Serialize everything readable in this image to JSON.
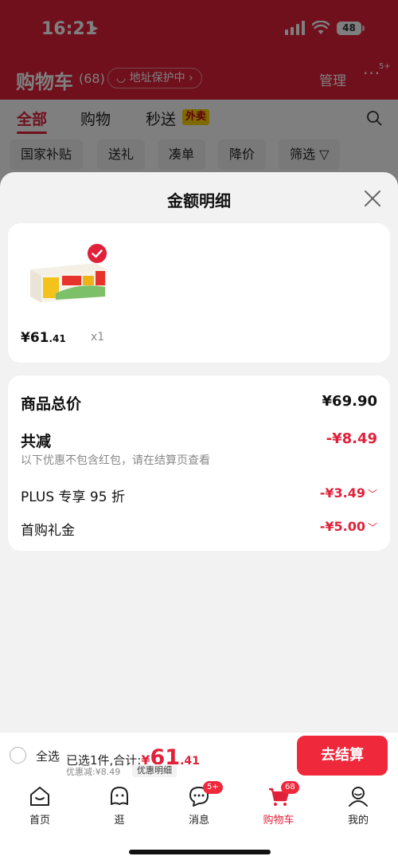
{
  "status_bar": {
    "time": "16:21",
    "battery": "48"
  },
  "header": {
    "title": "购物车",
    "count": "(68)",
    "address_pill": "地址保护中",
    "manage": "管理",
    "more_badge": "5+"
  },
  "tabs": [
    {
      "label": "全部"
    },
    {
      "label": "购物"
    },
    {
      "label": "秒送"
    }
  ],
  "waimai_tag": "外卖",
  "filters": [
    {
      "label": "国家补贴"
    },
    {
      "label": "送礼"
    },
    {
      "label": "凑单"
    },
    {
      "label": "降价"
    },
    {
      "label": "筛选"
    }
  ],
  "sheet": {
    "title": "金额明细",
    "product": {
      "price_int": "¥61",
      "price_dec": ".41",
      "qty": "x1"
    },
    "rows": {
      "total_label": "商品总价",
      "total_value": "¥69.90",
      "reduce_label": "共减",
      "reduce_value": "-¥8.49",
      "reduce_note": "以下优惠不包含红包，请在结算页查看",
      "plus_label": "PLUS 专享 95 折",
      "plus_value": "-¥3.49",
      "gift_label": "首购礼金",
      "gift_value": "-¥5.00"
    }
  },
  "checkout": {
    "select_all": "全选",
    "summary_prefix": "已选1件,合计:",
    "currency": "¥",
    "amount_int": "61",
    "amount_dec": ".41",
    "discount": "优惠减:¥8.49",
    "detail_link": "优惠明细",
    "button": "去结算"
  },
  "tabbar": [
    {
      "label": "首页"
    },
    {
      "label": "逛"
    },
    {
      "label": "消息",
      "badge": "5+"
    },
    {
      "label": "购物车",
      "badge": "68"
    },
    {
      "label": "我的"
    }
  ],
  "colors": {
    "brand_red": "#e0213a",
    "button_red": "#f0283b"
  }
}
